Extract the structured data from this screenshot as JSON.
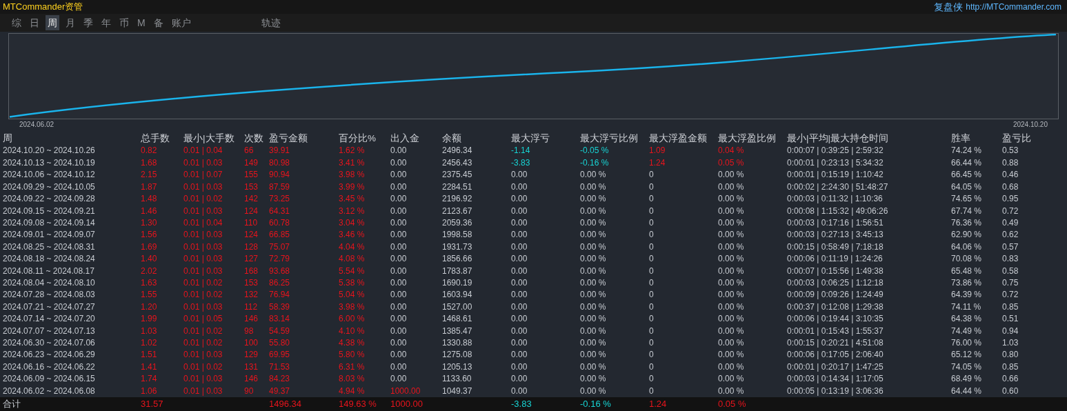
{
  "header": {
    "title": "MTCommander资管",
    "brand": "复盘侠",
    "url": "http://MTCommander.com"
  },
  "tabs": [
    {
      "label": "综",
      "selected": false
    },
    {
      "label": "日",
      "selected": false
    },
    {
      "label": "周",
      "selected": true
    },
    {
      "label": "月",
      "selected": false
    },
    {
      "label": "季",
      "selected": false
    },
    {
      "label": "年",
      "selected": false
    },
    {
      "label": "币",
      "selected": false
    },
    {
      "label": "M",
      "selected": false
    },
    {
      "label": "备",
      "selected": false
    },
    {
      "label": "账户",
      "selected": false
    },
    {
      "label": "轨迹",
      "selected": false
    }
  ],
  "chart": {
    "start_label": "2024.06.02",
    "end_label": "2024.10.20"
  },
  "table": {
    "columns": [
      "周",
      "总手数",
      "最小|大手数",
      "次数",
      "盈亏金额",
      "百分比%",
      "出入金",
      "余额",
      "最大浮亏",
      "最大浮亏比例",
      "最大浮盈金额",
      "最大浮盈比例",
      "最小|平均|最大持仓时间",
      "胜率",
      "盈亏比"
    ],
    "rows": [
      [
        {
          "text": "2024.10.20 ~ 2024.10.26"
        },
        {
          "text": "0.82",
          "color": "#e8141c"
        },
        {
          "text": "0.01 | 0.04",
          "color": "#e8141c"
        },
        {
          "text": "66",
          "color": "#e8141c"
        },
        {
          "text": "39.91",
          "color": "#e8141c"
        },
        {
          "text": "1.62 %",
          "color": "#e8141c"
        },
        {
          "text": "0.00"
        },
        {
          "text": "2496.34"
        },
        {
          "text": "-1.14",
          "color": "#17d4d4"
        },
        {
          "text": "-0.05 %",
          "color": "#17d4d4"
        },
        {
          "text": "1.09",
          "color": "#e8141c"
        },
        {
          "text": "0.04 %",
          "color": "#e8141c"
        },
        {
          "text": "0:00:07 | 0:39:25 | 2:59:32"
        },
        {
          "text": "74.24 %"
        },
        {
          "text": "0.53"
        }
      ],
      [
        {
          "text": "2024.10.13 ~ 2024.10.19"
        },
        {
          "text": "1.68",
          "color": "#e8141c"
        },
        {
          "text": "0.01 | 0.03",
          "color": "#e8141c"
        },
        {
          "text": "149",
          "color": "#e8141c"
        },
        {
          "text": "80.98",
          "color": "#e8141c"
        },
        {
          "text": "3.41 %",
          "color": "#e8141c"
        },
        {
          "text": "0.00"
        },
        {
          "text": "2456.43"
        },
        {
          "text": "-3.83",
          "color": "#17d4d4"
        },
        {
          "text": "-0.16 %",
          "color": "#17d4d4"
        },
        {
          "text": "1.24",
          "color": "#e8141c"
        },
        {
          "text": "0.05 %",
          "color": "#e8141c"
        },
        {
          "text": "0:00:01 | 0:23:13 | 5:34:32"
        },
        {
          "text": "66.44 %"
        },
        {
          "text": "0.88"
        }
      ],
      [
        {
          "text": "2024.10.06 ~ 2024.10.12"
        },
        {
          "text": "2.15",
          "color": "#e8141c"
        },
        {
          "text": "0.01 | 0.07",
          "color": "#e8141c"
        },
        {
          "text": "155",
          "color": "#e8141c"
        },
        {
          "text": "90.94",
          "color": "#e8141c"
        },
        {
          "text": "3.98 %",
          "color": "#e8141c"
        },
        {
          "text": "0.00"
        },
        {
          "text": "2375.45"
        },
        {
          "text": "0.00"
        },
        {
          "text": "0.00 %"
        },
        {
          "text": "0"
        },
        {
          "text": "0.00 %"
        },
        {
          "text": "0:00:01 | 0:15:19 | 1:10:42"
        },
        {
          "text": "66.45 %"
        },
        {
          "text": "0.46"
        }
      ],
      [
        {
          "text": "2024.09.29 ~ 2024.10.05"
        },
        {
          "text": "1.87",
          "color": "#e8141c"
        },
        {
          "text": "0.01 | 0.03",
          "color": "#e8141c"
        },
        {
          "text": "153",
          "color": "#e8141c"
        },
        {
          "text": "87.59",
          "color": "#e8141c"
        },
        {
          "text": "3.99 %",
          "color": "#e8141c"
        },
        {
          "text": "0.00"
        },
        {
          "text": "2284.51"
        },
        {
          "text": "0.00"
        },
        {
          "text": "0.00 %"
        },
        {
          "text": "0"
        },
        {
          "text": "0.00 %"
        },
        {
          "text": "0:00:02 | 2:24:30 | 51:48:27"
        },
        {
          "text": "64.05 %"
        },
        {
          "text": "0.68"
        }
      ],
      [
        {
          "text": "2024.09.22 ~ 2024.09.28"
        },
        {
          "text": "1.48",
          "color": "#e8141c"
        },
        {
          "text": "0.01 | 0.02",
          "color": "#e8141c"
        },
        {
          "text": "142",
          "color": "#e8141c"
        },
        {
          "text": "73.25",
          "color": "#e8141c"
        },
        {
          "text": "3.45 %",
          "color": "#e8141c"
        },
        {
          "text": "0.00"
        },
        {
          "text": "2196.92"
        },
        {
          "text": "0.00"
        },
        {
          "text": "0.00 %"
        },
        {
          "text": "0"
        },
        {
          "text": "0.00 %"
        },
        {
          "text": "0:00:03 | 0:11:32 | 1:10:36"
        },
        {
          "text": "74.65 %"
        },
        {
          "text": "0.95"
        }
      ],
      [
        {
          "text": "2024.09.15 ~ 2024.09.21"
        },
        {
          "text": "1.46",
          "color": "#e8141c"
        },
        {
          "text": "0.01 | 0.03",
          "color": "#e8141c"
        },
        {
          "text": "124",
          "color": "#e8141c"
        },
        {
          "text": "64.31",
          "color": "#e8141c"
        },
        {
          "text": "3.12 %",
          "color": "#e8141c"
        },
        {
          "text": "0.00"
        },
        {
          "text": "2123.67"
        },
        {
          "text": "0.00"
        },
        {
          "text": "0.00 %"
        },
        {
          "text": "0"
        },
        {
          "text": "0.00 %"
        },
        {
          "text": "0:00:08 | 1:15:32 | 49:06:26"
        },
        {
          "text": "67.74 %"
        },
        {
          "text": "0.72"
        }
      ],
      [
        {
          "text": "2024.09.08 ~ 2024.09.14"
        },
        {
          "text": "1.30",
          "color": "#e8141c"
        },
        {
          "text": "0.01 | 0.04",
          "color": "#e8141c"
        },
        {
          "text": "110",
          "color": "#e8141c"
        },
        {
          "text": "60.78",
          "color": "#e8141c"
        },
        {
          "text": "3.04 %",
          "color": "#e8141c"
        },
        {
          "text": "0.00"
        },
        {
          "text": "2059.36"
        },
        {
          "text": "0.00"
        },
        {
          "text": "0.00 %"
        },
        {
          "text": "0"
        },
        {
          "text": "0.00 %"
        },
        {
          "text": "0:00:03 | 0:17:16 | 1:56:51"
        },
        {
          "text": "76.36 %"
        },
        {
          "text": "0.49"
        }
      ],
      [
        {
          "text": "2024.09.01 ~ 2024.09.07"
        },
        {
          "text": "1.56",
          "color": "#e8141c"
        },
        {
          "text": "0.01 | 0.03",
          "color": "#e8141c"
        },
        {
          "text": "124",
          "color": "#e8141c"
        },
        {
          "text": "66.85",
          "color": "#e8141c"
        },
        {
          "text": "3.46 %",
          "color": "#e8141c"
        },
        {
          "text": "0.00"
        },
        {
          "text": "1998.58"
        },
        {
          "text": "0.00"
        },
        {
          "text": "0.00 %"
        },
        {
          "text": "0"
        },
        {
          "text": "0.00 %"
        },
        {
          "text": "0:00:03 | 0:27:13 | 3:45:13"
        },
        {
          "text": "62.90 %"
        },
        {
          "text": "0.62"
        }
      ],
      [
        {
          "text": "2024.08.25 ~ 2024.08.31"
        },
        {
          "text": "1.69",
          "color": "#e8141c"
        },
        {
          "text": "0.01 | 0.03",
          "color": "#e8141c"
        },
        {
          "text": "128",
          "color": "#e8141c"
        },
        {
          "text": "75.07",
          "color": "#e8141c"
        },
        {
          "text": "4.04 %",
          "color": "#e8141c"
        },
        {
          "text": "0.00"
        },
        {
          "text": "1931.73"
        },
        {
          "text": "0.00"
        },
        {
          "text": "0.00 %"
        },
        {
          "text": "0"
        },
        {
          "text": "0.00 %"
        },
        {
          "text": "0:00:15 | 0:58:49 | 7:18:18"
        },
        {
          "text": "64.06 %"
        },
        {
          "text": "0.57"
        }
      ],
      [
        {
          "text": "2024.08.18 ~ 2024.08.24"
        },
        {
          "text": "1.40",
          "color": "#e8141c"
        },
        {
          "text": "0.01 | 0.03",
          "color": "#e8141c"
        },
        {
          "text": "127",
          "color": "#e8141c"
        },
        {
          "text": "72.79",
          "color": "#e8141c"
        },
        {
          "text": "4.08 %",
          "color": "#e8141c"
        },
        {
          "text": "0.00"
        },
        {
          "text": "1856.66"
        },
        {
          "text": "0.00"
        },
        {
          "text": "0.00 %"
        },
        {
          "text": "0"
        },
        {
          "text": "0.00 %"
        },
        {
          "text": "0:00:06 | 0:11:19 | 1:24:26"
        },
        {
          "text": "70.08 %"
        },
        {
          "text": "0.83"
        }
      ],
      [
        {
          "text": "2024.08.11 ~ 2024.08.17"
        },
        {
          "text": "2.02",
          "color": "#e8141c"
        },
        {
          "text": "0.01 | 0.03",
          "color": "#e8141c"
        },
        {
          "text": "168",
          "color": "#e8141c"
        },
        {
          "text": "93.68",
          "color": "#e8141c"
        },
        {
          "text": "5.54 %",
          "color": "#e8141c"
        },
        {
          "text": "0.00"
        },
        {
          "text": "1783.87"
        },
        {
          "text": "0.00"
        },
        {
          "text": "0.00 %"
        },
        {
          "text": "0"
        },
        {
          "text": "0.00 %"
        },
        {
          "text": "0:00:07 | 0:15:56 | 1:49:38"
        },
        {
          "text": "65.48 %"
        },
        {
          "text": "0.58"
        }
      ],
      [
        {
          "text": "2024.08.04 ~ 2024.08.10"
        },
        {
          "text": "1.63",
          "color": "#e8141c"
        },
        {
          "text": "0.01 | 0.02",
          "color": "#e8141c"
        },
        {
          "text": "153",
          "color": "#e8141c"
        },
        {
          "text": "86.25",
          "color": "#e8141c"
        },
        {
          "text": "5.38 %",
          "color": "#e8141c"
        },
        {
          "text": "0.00"
        },
        {
          "text": "1690.19"
        },
        {
          "text": "0.00"
        },
        {
          "text": "0.00 %"
        },
        {
          "text": "0"
        },
        {
          "text": "0.00 %"
        },
        {
          "text": "0:00:03 | 0:06:25 | 1:12:18"
        },
        {
          "text": "73.86 %"
        },
        {
          "text": "0.75"
        }
      ],
      [
        {
          "text": "2024.07.28 ~ 2024.08.03"
        },
        {
          "text": "1.55",
          "color": "#e8141c"
        },
        {
          "text": "0.01 | 0.02",
          "color": "#e8141c"
        },
        {
          "text": "132",
          "color": "#e8141c"
        },
        {
          "text": "76.94",
          "color": "#e8141c"
        },
        {
          "text": "5.04 %",
          "color": "#e8141c"
        },
        {
          "text": "0.00"
        },
        {
          "text": "1603.94"
        },
        {
          "text": "0.00"
        },
        {
          "text": "0.00 %"
        },
        {
          "text": "0"
        },
        {
          "text": "0.00 %"
        },
        {
          "text": "0:00:09 | 0:09:26 | 1:24:49"
        },
        {
          "text": "64.39 %"
        },
        {
          "text": "0.72"
        }
      ],
      [
        {
          "text": "2024.07.21 ~ 2024.07.27"
        },
        {
          "text": "1.20",
          "color": "#e8141c"
        },
        {
          "text": "0.01 | 0.03",
          "color": "#e8141c"
        },
        {
          "text": "112",
          "color": "#e8141c"
        },
        {
          "text": "58.39",
          "color": "#e8141c"
        },
        {
          "text": "3.98 %",
          "color": "#e8141c"
        },
        {
          "text": "0.00"
        },
        {
          "text": "1527.00"
        },
        {
          "text": "0.00"
        },
        {
          "text": "0.00 %"
        },
        {
          "text": "0"
        },
        {
          "text": "0.00 %"
        },
        {
          "text": "0:00:37 | 0:12:08 | 1:29:38"
        },
        {
          "text": "74.11 %"
        },
        {
          "text": "0.85"
        }
      ],
      [
        {
          "text": "2024.07.14 ~ 2024.07.20"
        },
        {
          "text": "1.99",
          "color": "#e8141c"
        },
        {
          "text": "0.01 | 0.05",
          "color": "#e8141c"
        },
        {
          "text": "146",
          "color": "#e8141c"
        },
        {
          "text": "83.14",
          "color": "#e8141c"
        },
        {
          "text": "6.00 %",
          "color": "#e8141c"
        },
        {
          "text": "0.00"
        },
        {
          "text": "1468.61"
        },
        {
          "text": "0.00"
        },
        {
          "text": "0.00 %"
        },
        {
          "text": "0"
        },
        {
          "text": "0.00 %"
        },
        {
          "text": "0:00:06 | 0:19:44 | 3:10:35"
        },
        {
          "text": "64.38 %"
        },
        {
          "text": "0.51"
        }
      ],
      [
        {
          "text": "2024.07.07 ~ 2024.07.13"
        },
        {
          "text": "1.03",
          "color": "#e8141c"
        },
        {
          "text": "0.01 | 0.02",
          "color": "#e8141c"
        },
        {
          "text": "98",
          "color": "#e8141c"
        },
        {
          "text": "54.59",
          "color": "#e8141c"
        },
        {
          "text": "4.10 %",
          "color": "#e8141c"
        },
        {
          "text": "0.00"
        },
        {
          "text": "1385.47"
        },
        {
          "text": "0.00"
        },
        {
          "text": "0.00 %"
        },
        {
          "text": "0"
        },
        {
          "text": "0.00 %"
        },
        {
          "text": "0:00:01 | 0:15:43 | 1:55:37"
        },
        {
          "text": "74.49 %"
        },
        {
          "text": "0.94"
        }
      ],
      [
        {
          "text": "2024.06.30 ~ 2024.07.06"
        },
        {
          "text": "1.02",
          "color": "#e8141c"
        },
        {
          "text": "0.01 | 0.02",
          "color": "#e8141c"
        },
        {
          "text": "100",
          "color": "#e8141c"
        },
        {
          "text": "55.80",
          "color": "#e8141c"
        },
        {
          "text": "4.38 %",
          "color": "#e8141c"
        },
        {
          "text": "0.00"
        },
        {
          "text": "1330.88"
        },
        {
          "text": "0.00"
        },
        {
          "text": "0.00 %"
        },
        {
          "text": "0"
        },
        {
          "text": "0.00 %"
        },
        {
          "text": "0:00:15 | 0:20:21 | 4:51:08"
        },
        {
          "text": "76.00 %"
        },
        {
          "text": "1.03"
        }
      ],
      [
        {
          "text": "2024.06.23 ~ 2024.06.29"
        },
        {
          "text": "1.51",
          "color": "#e8141c"
        },
        {
          "text": "0.01 | 0.03",
          "color": "#e8141c"
        },
        {
          "text": "129",
          "color": "#e8141c"
        },
        {
          "text": "69.95",
          "color": "#e8141c"
        },
        {
          "text": "5.80 %",
          "color": "#e8141c"
        },
        {
          "text": "0.00"
        },
        {
          "text": "1275.08"
        },
        {
          "text": "0.00"
        },
        {
          "text": "0.00 %"
        },
        {
          "text": "0"
        },
        {
          "text": "0.00 %"
        },
        {
          "text": "0:00:06 | 0:17:05 | 2:06:40"
        },
        {
          "text": "65.12 %"
        },
        {
          "text": "0.80"
        }
      ],
      [
        {
          "text": "2024.06.16 ~ 2024.06.22"
        },
        {
          "text": "1.41",
          "color": "#e8141c"
        },
        {
          "text": "0.01 | 0.02",
          "color": "#e8141c"
        },
        {
          "text": "131",
          "color": "#e8141c"
        },
        {
          "text": "71.53",
          "color": "#e8141c"
        },
        {
          "text": "6.31 %",
          "color": "#e8141c"
        },
        {
          "text": "0.00"
        },
        {
          "text": "1205.13"
        },
        {
          "text": "0.00"
        },
        {
          "text": "0.00 %"
        },
        {
          "text": "0"
        },
        {
          "text": "0.00 %"
        },
        {
          "text": "0:00:01 | 0:20:17 | 1:47:25"
        },
        {
          "text": "74.05 %"
        },
        {
          "text": "0.85"
        }
      ],
      [
        {
          "text": "2024.06.09 ~ 2024.06.15"
        },
        {
          "text": "1.74",
          "color": "#e8141c"
        },
        {
          "text": "0.01 | 0.03",
          "color": "#e8141c"
        },
        {
          "text": "146",
          "color": "#e8141c"
        },
        {
          "text": "84.23",
          "color": "#e8141c"
        },
        {
          "text": "8.03 %",
          "color": "#e8141c"
        },
        {
          "text": "0.00"
        },
        {
          "text": "1133.60"
        },
        {
          "text": "0.00"
        },
        {
          "text": "0.00 %"
        },
        {
          "text": "0"
        },
        {
          "text": "0.00 %"
        },
        {
          "text": "0:00:03 | 0:14:34 | 1:17:05"
        },
        {
          "text": "68.49 %"
        },
        {
          "text": "0.66"
        }
      ],
      [
        {
          "text": "2024.06.02 ~ 2024.06.08"
        },
        {
          "text": "1.06",
          "color": "#e8141c"
        },
        {
          "text": "0.01 | 0.03",
          "color": "#e8141c"
        },
        {
          "text": "90",
          "color": "#e8141c"
        },
        {
          "text": "49.37",
          "color": "#e8141c"
        },
        {
          "text": "4.94 %",
          "color": "#e8141c"
        },
        {
          "text": "1000.00",
          "color": "#e8141c"
        },
        {
          "text": "1049.37"
        },
        {
          "text": "0.00"
        },
        {
          "text": "0.00 %"
        },
        {
          "text": "0"
        },
        {
          "text": "0.00 %"
        },
        {
          "text": "0:00:05 | 0:13:19 | 3:06:36"
        },
        {
          "text": "64.44 %"
        },
        {
          "text": "0.60"
        }
      ]
    ],
    "total": {
      "label": {
        "text": "合计"
      },
      "lots": {
        "text": "31.57",
        "color": "#e8141c"
      },
      "pnl": {
        "text": "1496.34",
        "color": "#e8141c"
      },
      "percent": {
        "text": "149.63 %",
        "color": "#e8141c"
      },
      "deposit": {
        "text": "1000.00",
        "color": "#e8141c"
      },
      "max_float_loss": {
        "text": "-3.83",
        "color": "#17d4d4"
      },
      "max_float_loss_pct": {
        "text": "-0.16 %",
        "color": "#17d4d4"
      },
      "max_float_profit": {
        "text": "1.24",
        "color": "#e8141c"
      },
      "max_float_profit_pct": {
        "text": "0.05 %",
        "color": "#e8141c"
      }
    }
  }
}
